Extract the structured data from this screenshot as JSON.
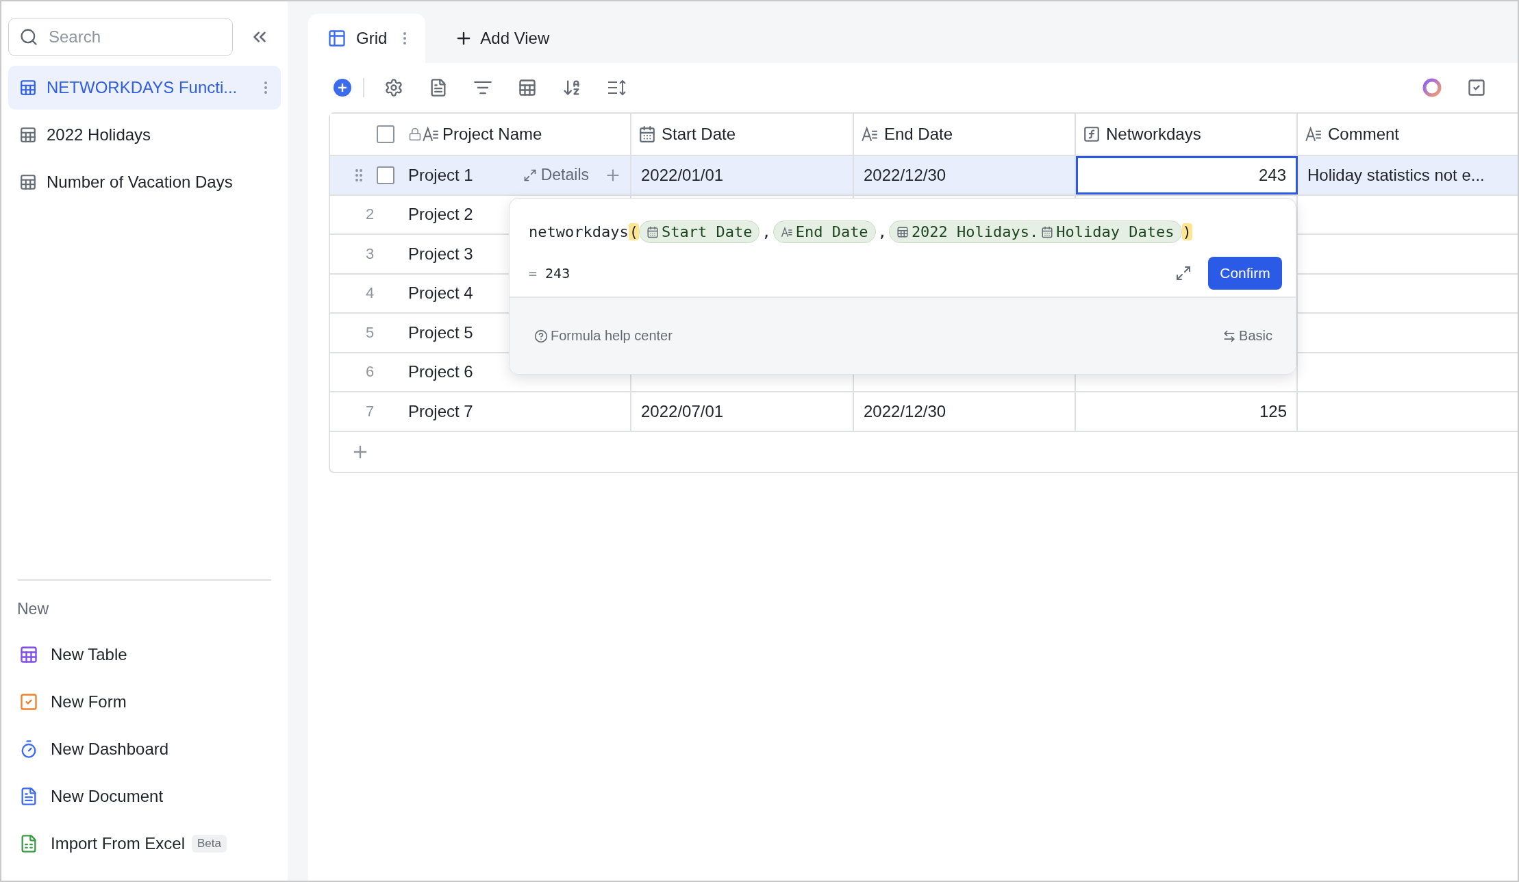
{
  "sidebar": {
    "search": {
      "placeholder": "Search"
    },
    "items": [
      {
        "label": "NETWORKDAYS Functi...",
        "selected": true
      },
      {
        "label": "2022 Holidays",
        "selected": false
      },
      {
        "label": "Number of Vacation Days",
        "selected": false
      }
    ],
    "new_section": {
      "title": "New",
      "items": [
        {
          "kind": "table",
          "label": "New Table"
        },
        {
          "kind": "form",
          "label": "New Form"
        },
        {
          "kind": "dashboard",
          "label": "New Dashboard"
        },
        {
          "kind": "document",
          "label": "New Document"
        },
        {
          "kind": "excel",
          "label": "Import From Excel",
          "badge": "Beta"
        }
      ]
    }
  },
  "view_tabs": [
    {
      "label": "Grid",
      "selected": true
    }
  ],
  "add_view": "Add View",
  "table": {
    "select_all_checked": false,
    "columns": [
      {
        "label": "Project Name",
        "kind": "text",
        "locked": true
      },
      {
        "label": "Start Date",
        "kind": "date",
        "locked": false
      },
      {
        "label": "End Date",
        "kind": "text",
        "locked": false
      },
      {
        "label": "Networkdays",
        "kind": "formula",
        "locked": false
      },
      {
        "label": "Comment",
        "kind": "text",
        "locked": false
      }
    ],
    "rows": [
      {
        "selected": true,
        "checked": false,
        "details": "Details",
        "cells": [
          {
            "text": "Project 1",
            "active": false
          },
          {
            "text": "2022/01/01",
            "active": false
          },
          {
            "text": "2022/12/30",
            "active": false
          },
          {
            "text": "243",
            "active": true
          },
          {
            "text": "Holiday statistics not e...",
            "active": false
          }
        ]
      },
      {
        "selected": false,
        "checked": false,
        "number": "2",
        "cells": [
          {
            "text": "Project 2",
            "active": false
          },
          null,
          null,
          null,
          null
        ]
      },
      {
        "selected": false,
        "checked": false,
        "number": "3",
        "cells": [
          {
            "text": "Project 3",
            "active": false
          },
          null,
          null,
          null,
          null
        ]
      },
      {
        "selected": false,
        "checked": false,
        "number": "4",
        "cells": [
          {
            "text": "Project 4",
            "active": false
          },
          null,
          null,
          null,
          null
        ]
      },
      {
        "selected": false,
        "checked": false,
        "number": "5",
        "cells": [
          {
            "text": "Project 5",
            "active": false
          },
          null,
          null,
          null,
          null
        ]
      },
      {
        "selected": false,
        "checked": false,
        "number": "6",
        "cells": [
          {
            "text": "Project 6",
            "active": false
          },
          null,
          null,
          null,
          null
        ]
      },
      {
        "selected": false,
        "checked": false,
        "number": "7",
        "cells": [
          {
            "text": "Project 7",
            "active": false
          },
          {
            "text": "2022/07/01",
            "active": false
          },
          {
            "text": "2022/12/30",
            "active": false
          },
          {
            "text": "125",
            "active": false
          },
          null
        ]
      }
    ]
  },
  "formula_editor": {
    "tokens": [
      {
        "kind": "function",
        "text": "networkdays"
      },
      {
        "kind": "paren",
        "text": "("
      },
      {
        "kind": "field",
        "parts": [
          {
            "kind": "date",
            "text": "Start Date"
          }
        ]
      },
      {
        "kind": "comma",
        "text": ","
      },
      {
        "kind": "field",
        "parts": [
          {
            "kind": "text",
            "text": "End Date"
          }
        ]
      },
      {
        "kind": "comma",
        "text": ","
      },
      {
        "kind": "field",
        "parts": [
          {
            "kind": "table",
            "text": "2022 Holidays."
          },
          {
            "kind": "date",
            "text": "Holiday Dates"
          }
        ]
      },
      {
        "kind": "paren",
        "text": ")"
      }
    ],
    "result_prefix": "=",
    "result": "243",
    "confirm": "Confirm",
    "help": "Formula help center",
    "mode": "Basic"
  }
}
